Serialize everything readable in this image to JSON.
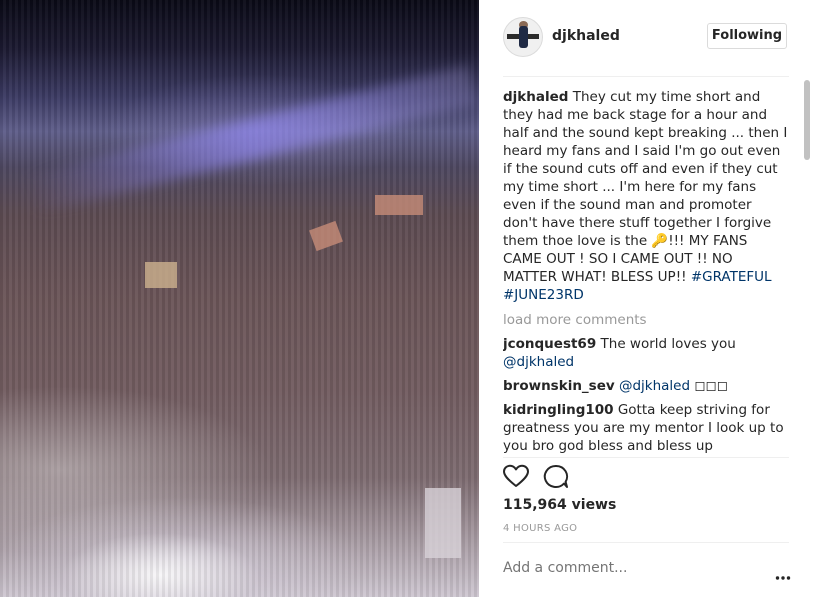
{
  "post": {
    "username": "djkhaled",
    "follow_label": "Following"
  },
  "caption": {
    "username": "djkhaled",
    "text_part1": " They cut my time short and they had me back stage for a hour and half and the sound kept breaking ... then I heard my fans and I said I'm go out even if the sound cuts off and even if they cut my time short ... I'm here for my fans even if the sound man and promoter don't have there stuff together I forgive them thoe love is the ",
    "key_emoji": "🔑",
    "text_part2": "!!! MY FANS CAME OUT ! SO I CAME OUT !! NO MATTER WHAT! BLESS UP!! ",
    "hashtag1": "#GRATEFUL",
    "hashtag2": "#JUNE23RD"
  },
  "load_more": "load more comments",
  "comments": [
    {
      "username": "jconquest69",
      "text": " The world loves you ",
      "mention": "@djkhaled"
    },
    {
      "username": "brownskin_sev",
      "mention": "@djkhaled",
      "text": " ◻◻◻"
    },
    {
      "username": "kidringling100",
      "text": " Gotta keep striving for greatness you are my mentor I look up to you bro god bless and bless up"
    }
  ],
  "stats": {
    "views": "115,964 views",
    "time": "4 HOURS AGO"
  },
  "add_comment": {
    "placeholder": "Add a comment..."
  },
  "icons": {
    "like": "heart-icon",
    "comment": "comment-bubble-icon",
    "more": "more-options-icon"
  },
  "colors": {
    "link": "#003569",
    "muted": "#999999",
    "border": "#dbdbdb"
  }
}
